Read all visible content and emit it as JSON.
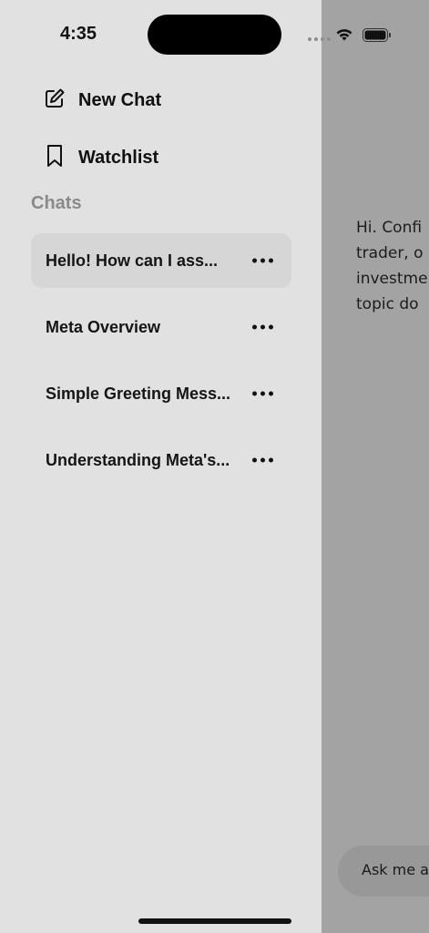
{
  "status_bar": {
    "time": "4:35"
  },
  "menu": {
    "new_chat": "New Chat",
    "watchlist": "Watchlist"
  },
  "chats": {
    "section_title": "Chats",
    "items": [
      {
        "title": "Hello! How can I ass...",
        "selected": true
      },
      {
        "title": "Meta Overview",
        "selected": false
      },
      {
        "title": "Simple Greeting Mess...",
        "selected": false
      },
      {
        "title": "Understanding Meta's...",
        "selected": false
      }
    ]
  },
  "main": {
    "message_lines": [
      "Hi. Confi",
      "trader, o",
      "investme",
      "topic do"
    ],
    "input_placeholder": "Ask me a"
  }
}
